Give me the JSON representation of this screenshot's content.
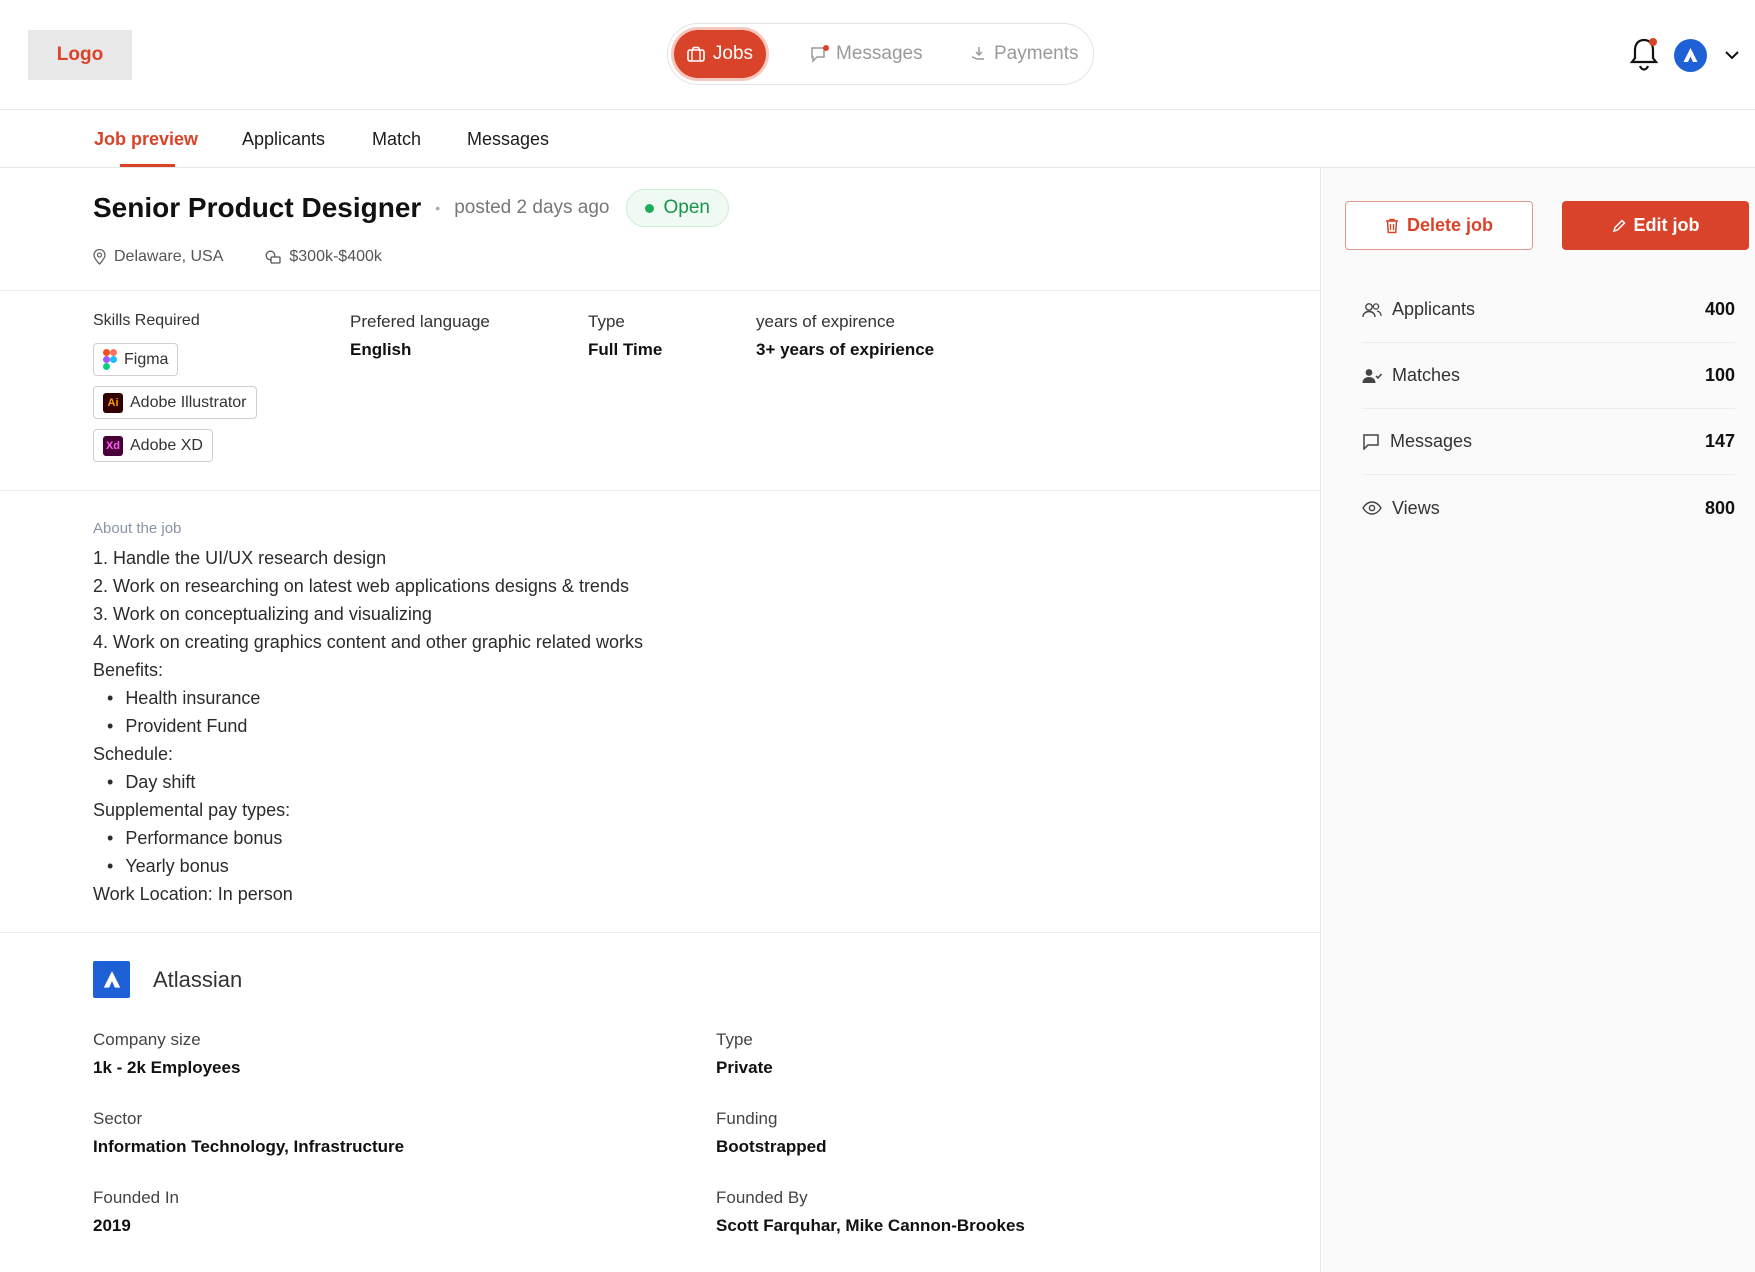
{
  "header": {
    "logo": "Logo",
    "nav": {
      "jobs": "Jobs",
      "messages": "Messages",
      "payments": "Payments"
    }
  },
  "tabs": [
    "Job preview",
    "Applicants",
    "Match",
    "Messages"
  ],
  "job": {
    "title": "Senior Product Designer",
    "posted": "posted 2 days ago",
    "status": "Open",
    "location": "Delaware, USA",
    "salary": "$300k-$400k",
    "skills_label": "Skills Required",
    "skills": [
      "Figma",
      "Adobe Illustrator",
      "Adobe XD"
    ],
    "language_label": "Prefered language",
    "language": "English",
    "type_label": "Type",
    "type": "Full Time",
    "experience_label": "years of expirence",
    "experience": "3+ years of expirience"
  },
  "about": {
    "label": "About the job",
    "lines": [
      "1. Handle the UI/UX research design",
      "2. Work on researching on latest web applications designs & trends",
      "3. Work on conceptualizing and visualizing",
      "4. Work on creating graphics content and other graphic related works"
    ],
    "benefits_label": "Benefits:",
    "benefits": [
      "Health insurance",
      "Provident Fund"
    ],
    "schedule_label": "Schedule:",
    "schedule": [
      "Day shift"
    ],
    "supplemental_label": "Supplemental pay types:",
    "supplemental": [
      "Performance bonus",
      "Yearly bonus"
    ],
    "work_location": "Work Location: In person"
  },
  "company": {
    "name": "Atlassian",
    "size_label": "Company size",
    "size": "1k - 2k Employees",
    "type_label": "Type",
    "type": "Private",
    "sector_label": "Sector",
    "sector": "Information Technology, Infrastructure",
    "funding_label": "Funding",
    "funding": "Bootstrapped",
    "founded_in_label": "Founded In",
    "founded_in": "2019",
    "founded_by_label": "Founded By",
    "founded_by": "Scott Farquhar, Mike Cannon-Brookes"
  },
  "sidebar": {
    "delete": "Delete job",
    "edit": "Edit job",
    "stats": [
      {
        "label": "Applicants",
        "value": "400",
        "icon": "users-icon"
      },
      {
        "label": "Matches",
        "value": "100",
        "icon": "user-check-icon"
      },
      {
        "label": "Messages",
        "value": "147",
        "icon": "chat-icon"
      },
      {
        "label": "Views",
        "value": "800",
        "icon": "eye-icon"
      }
    ]
  },
  "colors": {
    "accent": "#d9432a",
    "status": "#1fae58",
    "brand_blue": "#1e60d6"
  }
}
